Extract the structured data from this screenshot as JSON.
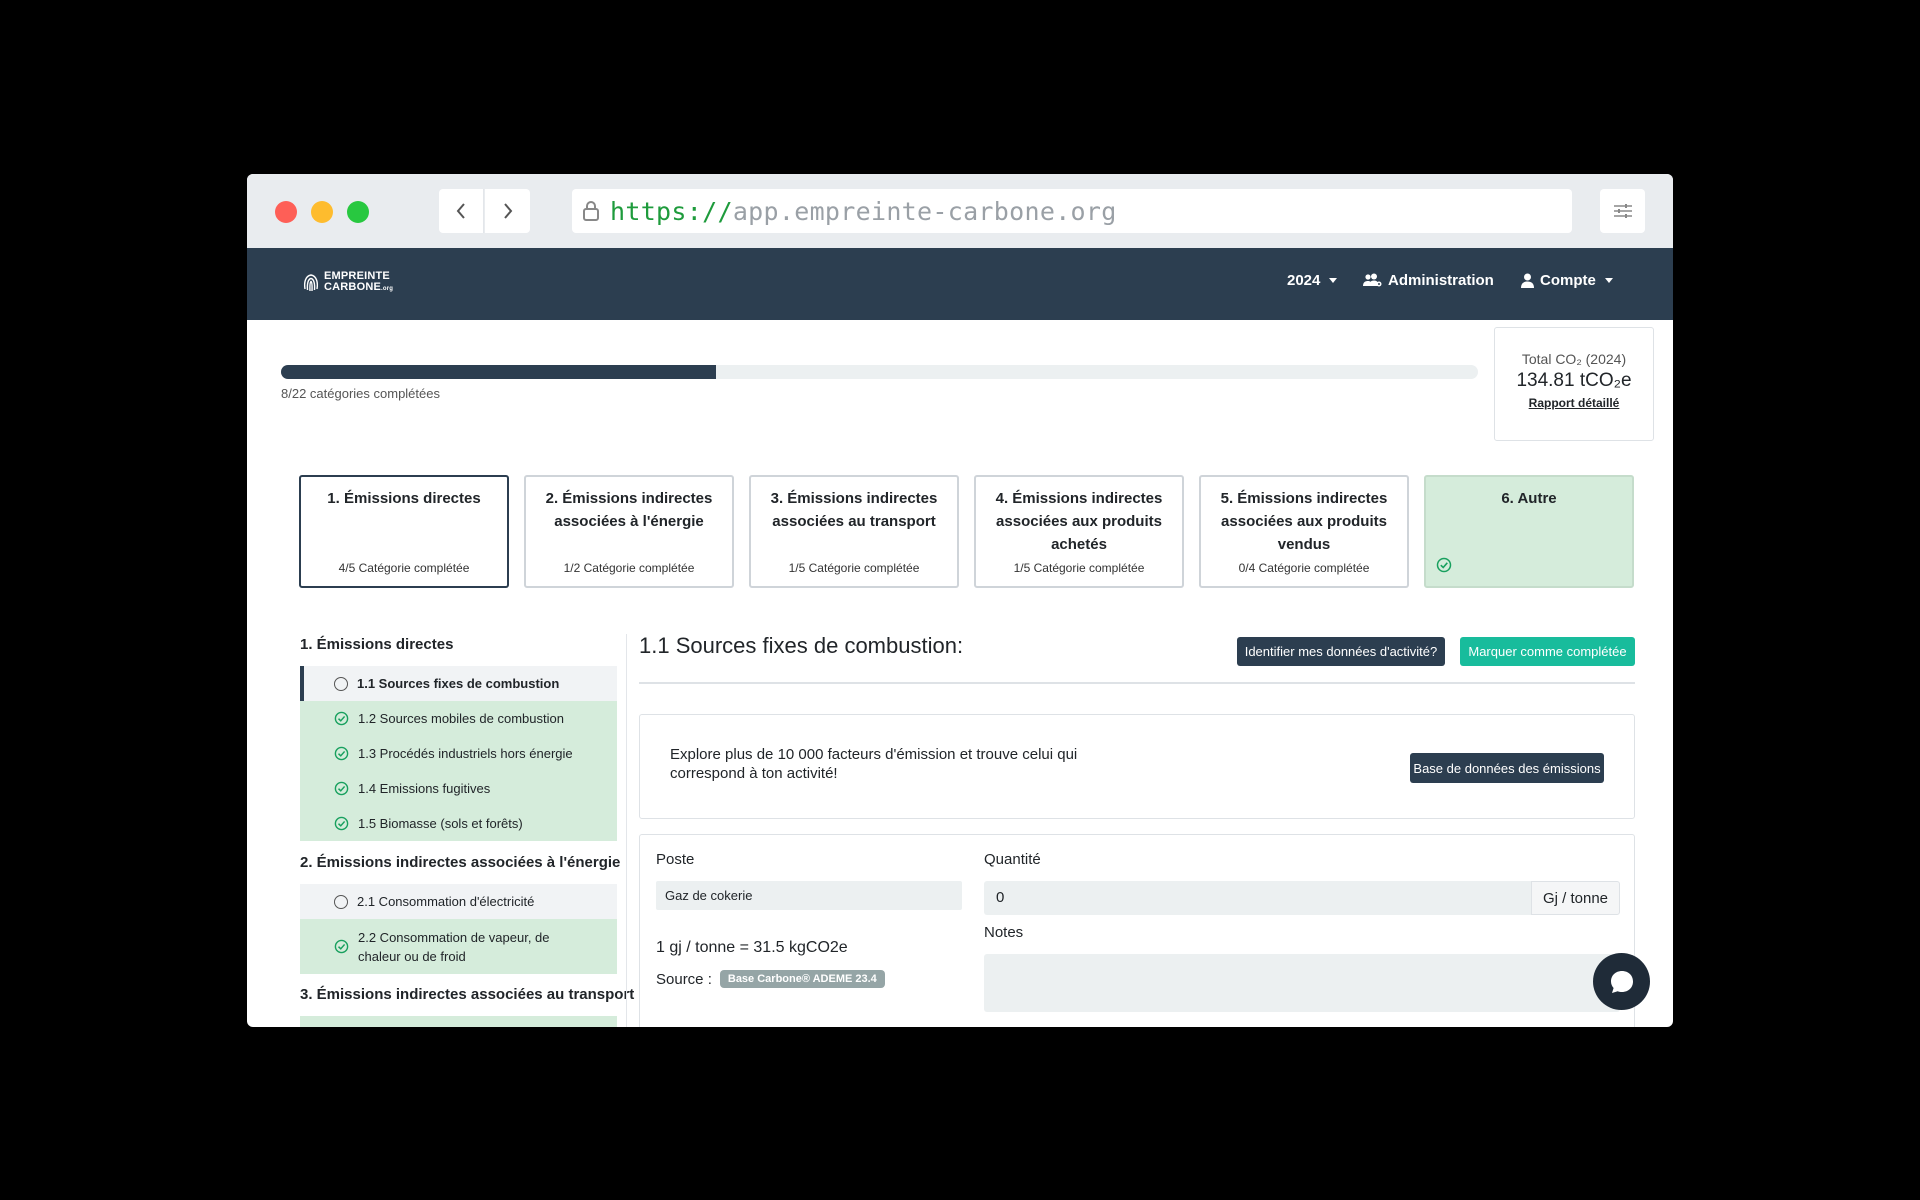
{
  "browser": {
    "url_scheme": "https://",
    "url_host": "app.empreinte-carbone.org"
  },
  "navbar": {
    "logo_line1": "EMPREINTE",
    "logo_line2": "CARBONE",
    "logo_suffix": ".org",
    "year": "2024",
    "admin": "Administration",
    "account": "Compte"
  },
  "progress": {
    "completed": 8,
    "total": 22,
    "label": "8/22 catégories complétées"
  },
  "total": {
    "label": "Total CO₂ (2024)",
    "value": "134.81 tCO₂e",
    "link": "Rapport détaillé"
  },
  "scopes": [
    {
      "title": "1. Émissions directes",
      "status": "4/5 Catégorie complétée"
    },
    {
      "title": "2. Émissions indirectes associées à l'énergie",
      "status": "1/2 Catégorie complétée"
    },
    {
      "title": "3. Émissions indirectes associées au transport",
      "status": "1/5 Catégorie complétée"
    },
    {
      "title": "4. Émissions indirectes associées aux produits achetés",
      "status": "1/5 Catégorie complétée"
    },
    {
      "title": "5. Émissions indirectes associées aux produits vendus",
      "status": "0/4 Catégorie complétée"
    },
    {
      "title": "6. Autre",
      "status": ""
    }
  ],
  "sidebar": {
    "sections": [
      {
        "heading": "1. Émissions directes",
        "items": [
          "1.1 Sources fixes de combustion",
          "1.2 Sources mobiles de combustion",
          "1.3 Procédés industriels hors énergie",
          "1.4 Emissions fugitives",
          "1.5 Biomasse (sols et forêts)"
        ]
      },
      {
        "heading": "2. Émissions indirectes associées à l'énergie",
        "items": [
          "2.1 Consommation d'électricité",
          "2.2 Consommation de vapeur, de chaleur ou de froid"
        ]
      },
      {
        "heading": "3. Émissions indirectes associées au transport",
        "items": []
      }
    ]
  },
  "main": {
    "title": "1.1 Sources fixes de combustion:",
    "btn_identify": "Identifier mes données d'activité?",
    "btn_complete": "Marquer comme complétée",
    "explore_text": "Explore plus de 10 000 facteurs d'émission et trouve celui qui correspond à ton activité!",
    "btn_database": "Base de données des émissions",
    "form": {
      "poste_label": "Poste",
      "poste_value": "Gaz de cokerie",
      "quantity_label": "Quantité",
      "quantity_value": "0",
      "unit": "Gj / tonne",
      "factor": "1 gj / tonne = 31.5 kgCO2e",
      "source_label": "Source :",
      "source_badge": "Base Carbone® ADEME 23.4",
      "notes_label": "Notes"
    }
  },
  "colors": {
    "navbar": "#2c3e50",
    "accent": "#18bc9c",
    "done": "#d5ecdb",
    "check": "#18a05e"
  }
}
